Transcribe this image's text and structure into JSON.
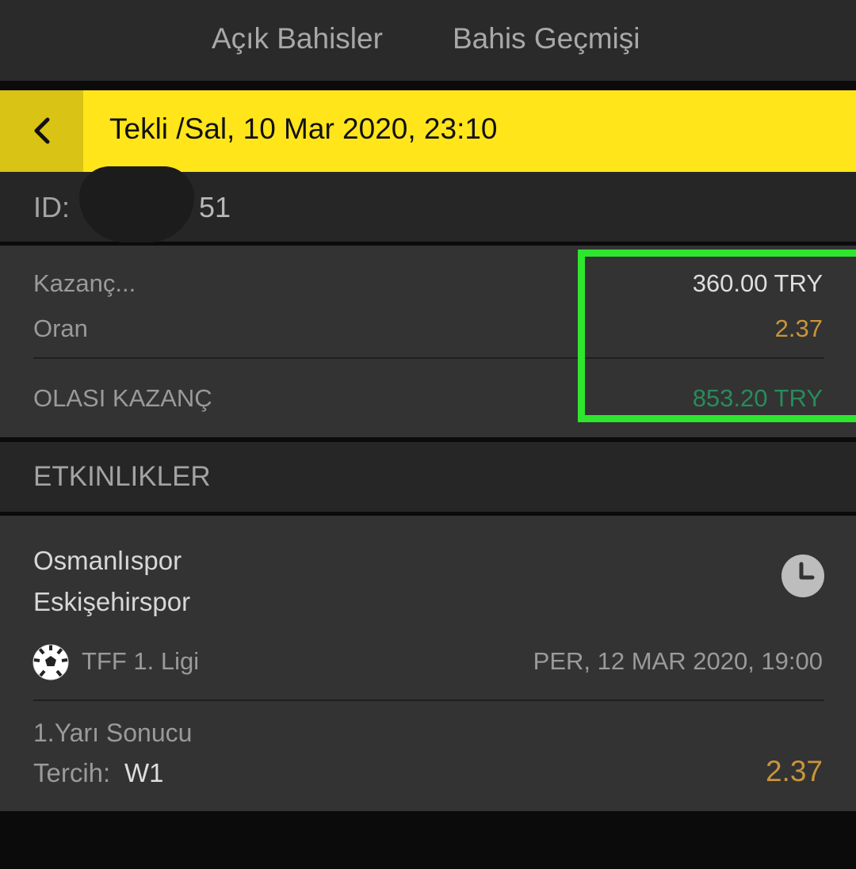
{
  "tabs": {
    "open_bets": "Açık Bahisler",
    "bet_history": "Bahis Geçmişi"
  },
  "header": {
    "title": "Tekli /Sal, 10 Mar 2020, 23:10"
  },
  "bet_id": {
    "label": "ID:",
    "value_visible": "51"
  },
  "summary": {
    "stake_label": "Kazanç...",
    "stake_value": "360.00 TRY",
    "odds_label": "Oran",
    "odds_value": "2.37",
    "potential_label": "OLASI KAZANÇ",
    "potential_value": "853.20 TRY"
  },
  "events": {
    "title": "ETKINLIKLER",
    "items": [
      {
        "home_team": "Osmanlıspor",
        "away_team": "Eskişehirspor",
        "league": "TFF 1. Ligi",
        "date": "PER, 12 MAR 2020, 19:00",
        "market": "1.Yarı Sonucu",
        "pick_label": "Tercih:",
        "pick_value": "W1",
        "odds": "2.37"
      }
    ]
  },
  "icons": {
    "back": "chevron-left-icon",
    "clock": "clock-icon",
    "sport": "soccer-ball-icon"
  },
  "colors": {
    "accent_yellow": "#ffe51a",
    "odds_gold": "#c9953b",
    "potential_green": "#2a8a5c",
    "highlight_green": "#2ee62e"
  }
}
